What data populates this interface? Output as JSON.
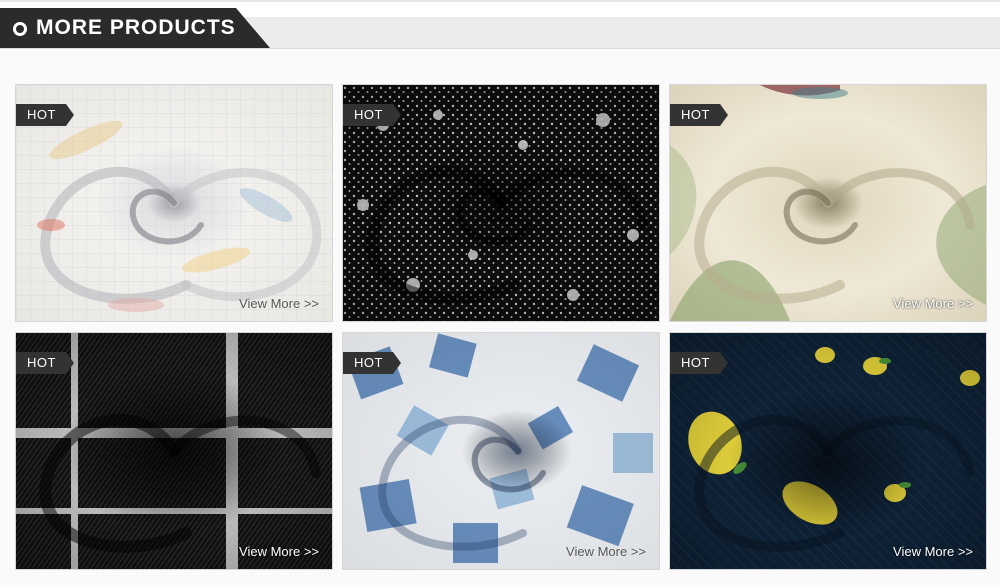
{
  "section": {
    "title": "MORE PRODUCTS"
  },
  "products": [
    {
      "badge": "HOT",
      "link_label": "View More >>",
      "icon": "fabric-swirl-pastel-plaid"
    },
    {
      "badge": "HOT",
      "link_label": "",
      "icon": "fabric-swirl-black-white-floral"
    },
    {
      "badge": "HOT",
      "link_label": "View More >>",
      "icon": "fabric-swirl-cream-botanical"
    },
    {
      "badge": "HOT",
      "link_label": "View More >>",
      "icon": "fabric-swirl-black-white-plaid"
    },
    {
      "badge": "HOT",
      "link_label": "View More >>",
      "icon": "fabric-swirl-blue-white-check"
    },
    {
      "badge": "HOT",
      "link_label": "View More >>",
      "icon": "fabric-swirl-navy-lemon"
    }
  ],
  "colors": {
    "header_dark": "#2b2b2b",
    "header_light": "#ececec",
    "badge": "#333333"
  }
}
